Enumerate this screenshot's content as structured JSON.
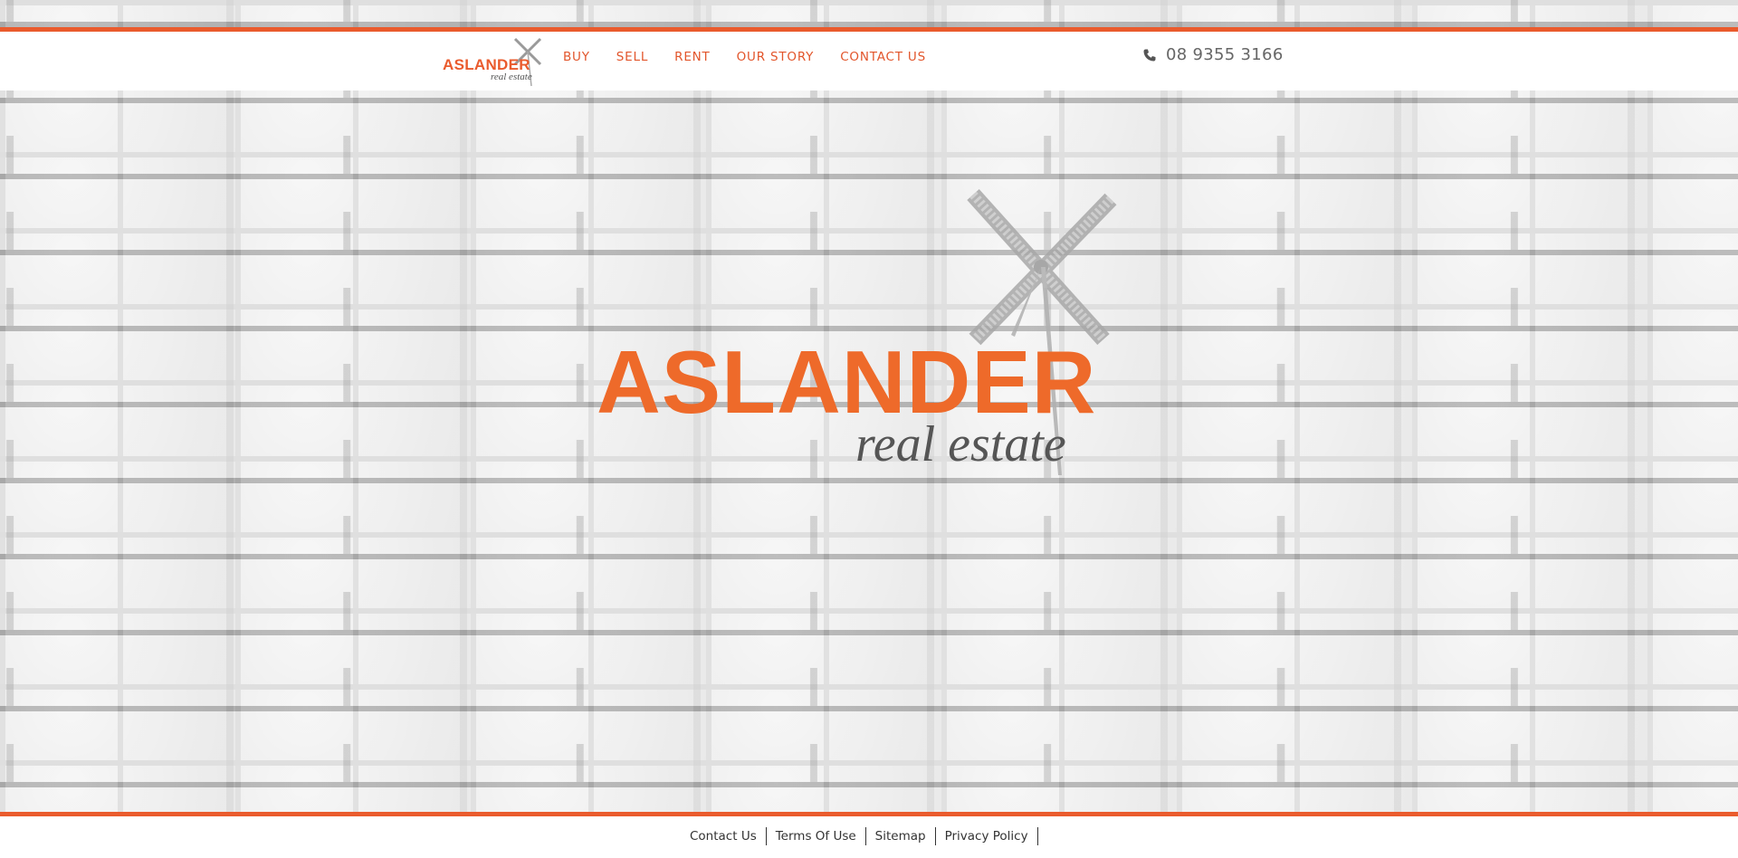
{
  "header": {
    "logo": {
      "brand": "ASLANDER",
      "sub": "real estate"
    },
    "nav": [
      {
        "label": "BUY"
      },
      {
        "label": "SELL"
      },
      {
        "label": "RENT"
      },
      {
        "label": "OUR STORY"
      },
      {
        "label": "CONTACT US"
      }
    ],
    "phone": {
      "icon": "phone-icon",
      "number": "08 9355 3166"
    }
  },
  "hero": {
    "brand": "ASLANDER",
    "sub": "real estate",
    "icon": "windmill-icon"
  },
  "footer": {
    "links": [
      {
        "label": "Contact Us"
      },
      {
        "label": "Terms Of Use"
      },
      {
        "label": "Sitemap"
      },
      {
        "label": "Privacy Policy"
      }
    ]
  },
  "colors": {
    "accent": "#ea5b2d",
    "text_dark": "#333333",
    "text_grey": "#666666",
    "background_wall": "#d9d9d9"
  }
}
